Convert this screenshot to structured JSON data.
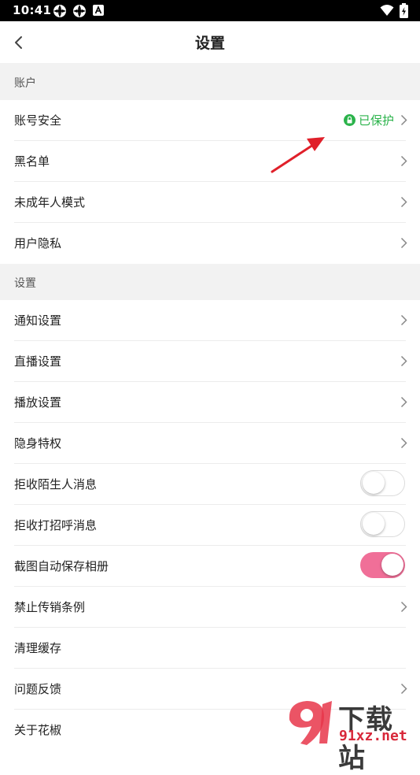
{
  "status_bar": {
    "time": "10:41"
  },
  "header": {
    "title": "设置"
  },
  "sections": {
    "account": {
      "header": "账户",
      "rows": {
        "account_security": "账号安全",
        "blacklist": "黑名单",
        "minor_mode": "未成年人模式",
        "user_privacy": "用户隐私"
      },
      "protect_status": "已保护"
    },
    "settings": {
      "header": "设置",
      "rows": {
        "notification": "通知设置",
        "live": "直播设置",
        "playback": "播放设置",
        "invisible": "隐身特权",
        "reject_stranger": "拒收陌生人消息",
        "reject_greeting": "拒收打招呼消息",
        "auto_save_screenshot": "截图自动保存相册",
        "anti_mlm": "禁止传销条例",
        "clear_cache": "清理缓存",
        "feedback": "问题反馈",
        "about": "关于花椒"
      }
    }
  },
  "toggles": {
    "reject_stranger": false,
    "reject_greeting": false,
    "auto_save_screenshot": true
  },
  "colors": {
    "toggle_on": "#f06f98",
    "protect_green": "#2bb34b",
    "section_bg": "#f2f2f2",
    "annotation_arrow": "#e0202a"
  },
  "watermark": {
    "text_top": "下载站",
    "text_bottom": "91xz.net"
  }
}
